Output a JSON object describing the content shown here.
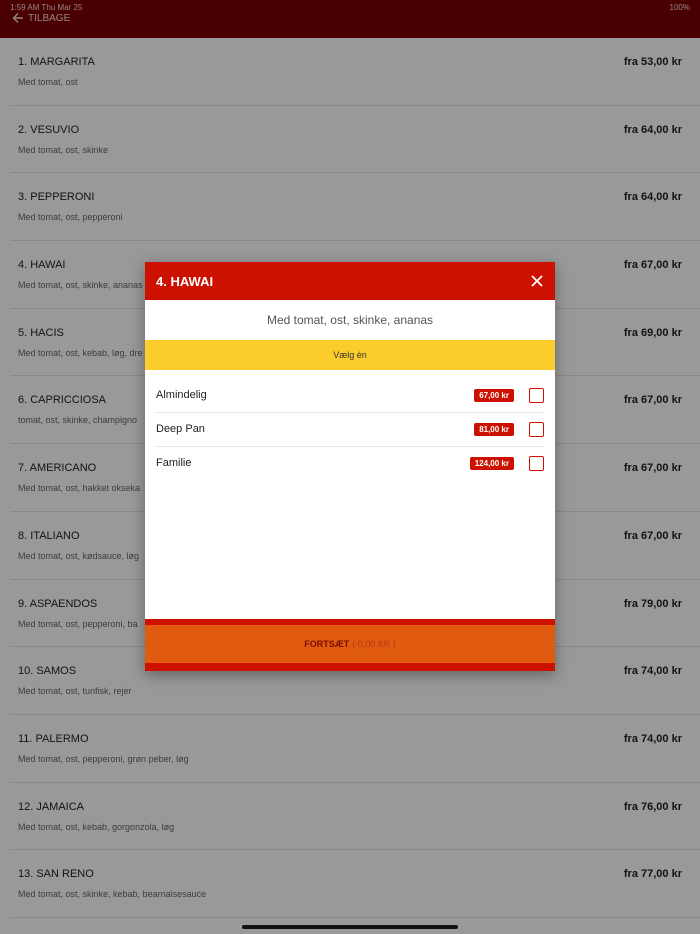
{
  "status": {
    "time": "1:59 AM  Thu Mar 25",
    "battery": "100%"
  },
  "header": {
    "back_label": "TILBAGE"
  },
  "menu": [
    {
      "name": "1. MARGARITA",
      "desc": "Med tomat, ost",
      "price": "fra 53,00 kr"
    },
    {
      "name": "2. VESUVIO",
      "desc": "Med tomat, ost, skinke",
      "price": "fra 64,00 kr"
    },
    {
      "name": "3. PEPPERONI",
      "desc": "Med tomat, ost, pepperoni",
      "price": "fra 64,00 kr"
    },
    {
      "name": "4. HAWAI",
      "desc": "Med tomat, ost, skinke, ananas",
      "price": "fra 67,00 kr"
    },
    {
      "name": "5. HACIS",
      "desc": "Med tomat, ost, kebab, løg, dre",
      "price": "fra 69,00 kr"
    },
    {
      "name": "6. CAPRICCIOSA",
      "desc": "tomat, ost, skinke, champigno",
      "price": "fra 67,00 kr"
    },
    {
      "name": "7. AMERICANO",
      "desc": "Med tomat, ost, hakket okseka",
      "price": "fra 67,00 kr"
    },
    {
      "name": "8. ITALIANO",
      "desc": "Med tomat, ost, kødsauce, løg",
      "price": "fra 67,00 kr"
    },
    {
      "name": "9. ASPAENDOS",
      "desc": "Med tomat, ost, pepperoni, ba",
      "price": "fra 79,00 kr"
    },
    {
      "name": "10. SAMOS",
      "desc": "Med tomat, ost, tunfisk, rejer",
      "price": "fra 74,00 kr"
    },
    {
      "name": "11. PALERMO",
      "desc": "Med tomat, ost, pepperoni, grøn peber, løg",
      "price": "fra 74,00 kr"
    },
    {
      "name": "12. JAMAICA",
      "desc": "Med tomat, ost, kebab, gorgonzola, løg",
      "price": "fra 76,00 kr"
    },
    {
      "name": "13. SAN RENO",
      "desc": "Med tomat, ost, skinke, kebab, bearnaisesauce",
      "price": "fra 77,00 kr"
    }
  ],
  "modal": {
    "title": "4. HAWAI",
    "description": "Med tomat, ost, skinke, ananas",
    "choose_label": "Vælg én",
    "options": [
      {
        "label": "Almindelig",
        "price": "67,00 kr"
      },
      {
        "label": "Deep Pan",
        "price": "81,00 kr"
      },
      {
        "label": "Familie",
        "price": "124,00 kr"
      }
    ],
    "continue_label": "FORTSÆT",
    "continue_total": "( 0,00 KR )"
  },
  "colors": {
    "header": "#7c0000",
    "accent": "#cc1100",
    "choose_bar": "#fbcc2c",
    "continue": "#e05a10"
  }
}
